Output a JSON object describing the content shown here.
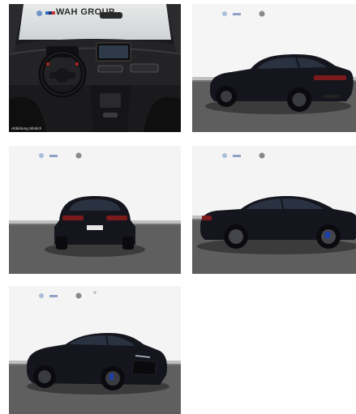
{
  "gallery": {
    "images": [
      {
        "id": "interior",
        "caption": "Abbildung ähnlich",
        "banner": "WAH GROUP"
      },
      {
        "id": "rear-three-quarter"
      },
      {
        "id": "rear"
      },
      {
        "id": "side-profile"
      },
      {
        "id": "front-three-quarter"
      }
    ]
  },
  "colors": {
    "car_body": "#14151d",
    "floor": "#5f5f5f",
    "backdrop": "#f4f4f4",
    "brake_caliper": "#1d3fa8",
    "taillight": "#7a1a1a"
  }
}
